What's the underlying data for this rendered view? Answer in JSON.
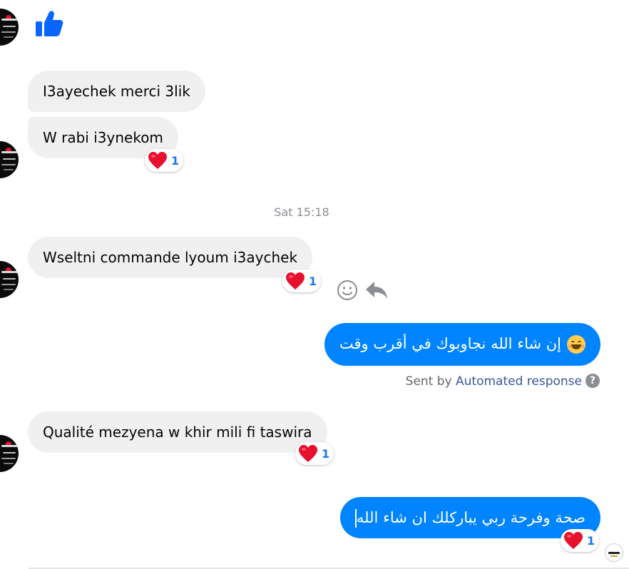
{
  "timestamp": "Sat 15:18",
  "messages": {
    "m1": "I3ayechek merci 3lik",
    "m2": "W rabi i3ynekom",
    "m3": "Wseltni commande lyoum i3aychek",
    "m4": "إن شاء الله نجاوبوك في أقرب وقت",
    "m5": "Qualité mezyena w khir mili fi taswira",
    "m6": "صحة وفرحة ربي يباركلك ان شاء الله"
  },
  "reactions": {
    "m2_count": "1",
    "m3_count": "1",
    "m5_count": "1",
    "m6_count": "1"
  },
  "sent_by": {
    "prefix": "Sent by",
    "link": "Automated response",
    "help": "?"
  },
  "colors": {
    "incoming_bubble": "#f0f0f0",
    "outgoing_bubble": "#0084ff",
    "link": "#385898",
    "reaction_count": "#1877f2",
    "like_icon": "#0866ff"
  },
  "icons": {
    "like": "thumbs-up-icon",
    "react": "smiley-face-icon",
    "reply": "reply-arrow-icon",
    "reaction": "red-heart-icon",
    "help": "question-circle-icon"
  }
}
